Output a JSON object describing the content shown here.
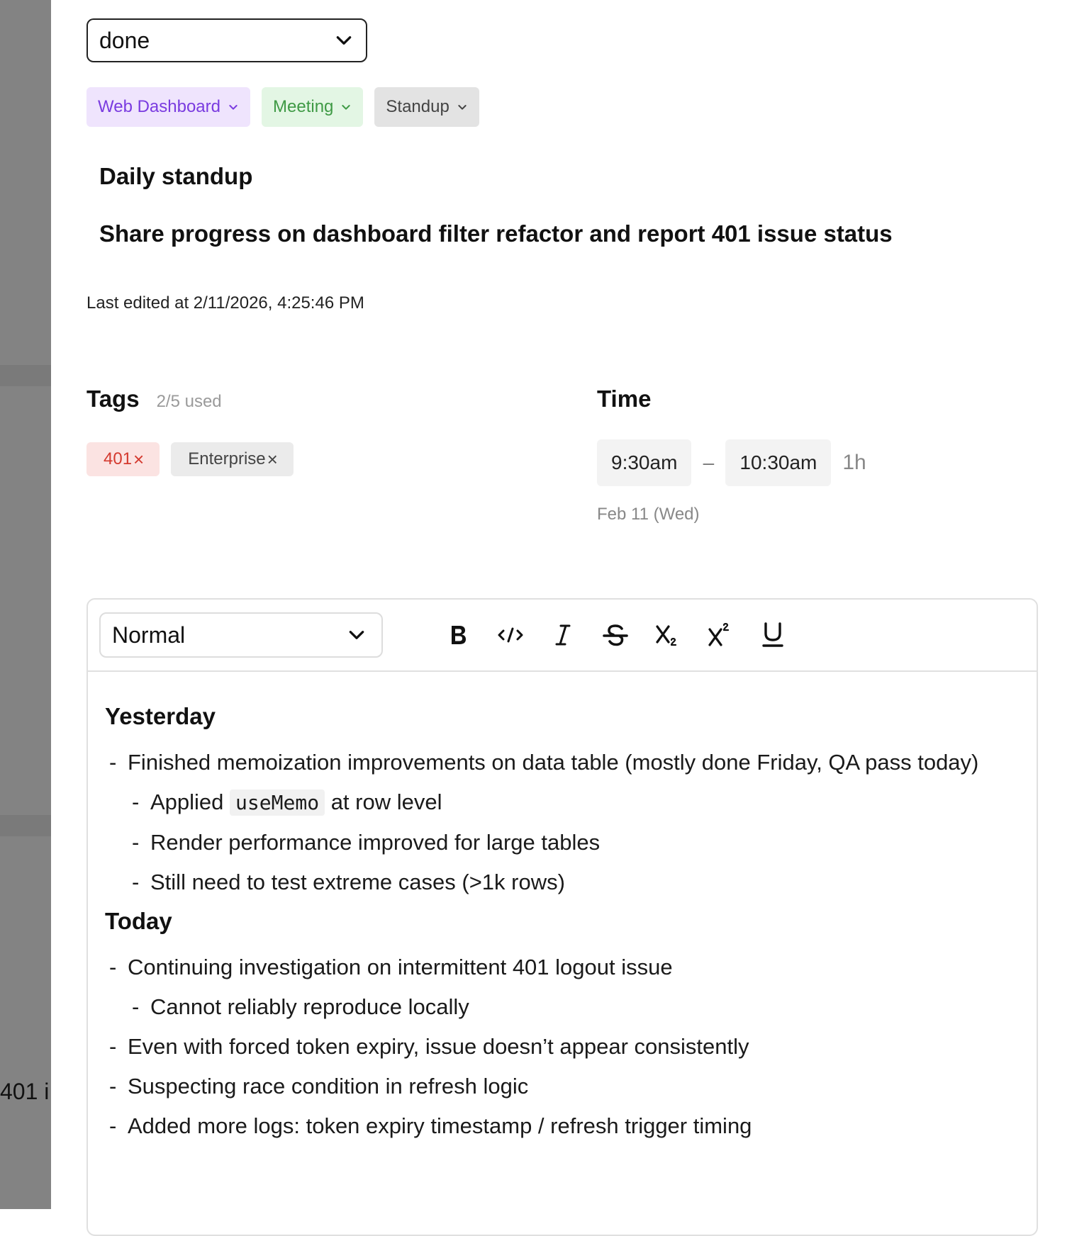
{
  "backdrop": {
    "peek_text": "401 i"
  },
  "status": {
    "value": "done"
  },
  "chips": [
    {
      "label": "Web Dashboard",
      "bg": "#efe4fd",
      "fg": "#7a3be0"
    },
    {
      "label": "Meeting",
      "bg": "#e3f6e4",
      "fg": "#3f9a45"
    },
    {
      "label": "Standup",
      "bg": "#e3e3e3",
      "fg": "#444444"
    }
  ],
  "title": "Daily standup",
  "subtitle": "Share progress on dashboard filter refactor and report 401 issue status",
  "last_edited": "Last edited at 2/11/2026, 4:25:46 PM",
  "tags": {
    "title": "Tags",
    "count": "2/5 used",
    "items": [
      {
        "label": "401",
        "remove": "×"
      },
      {
        "label": "Enterprise",
        "remove": "×"
      }
    ]
  },
  "time": {
    "title": "Time",
    "start": "9:30am",
    "separator": "–",
    "end": "10:30am",
    "duration": "1h",
    "date": "Feb 11 (Wed)"
  },
  "editor": {
    "format": "Normal",
    "toolbar": [
      "bold",
      "code",
      "italic",
      "strikethrough",
      "subscript",
      "superscript",
      "underline"
    ],
    "sections": [
      {
        "heading": "Yesterday",
        "item1": "Finished memoization improvements on data table (mostly done Friday, QA pass today)",
        "sub1_pre": "Applied",
        "sub1_code": "useMemo",
        "sub1_post": "at row level",
        "sub2": "Render performance improved for large tables",
        "sub3": "Still need to test extreme cases (>1k rows)"
      },
      {
        "heading": "Today",
        "item1": "Continuing investigation on intermittent 401 logout issue",
        "sub1": "Cannot reliably reproduce locally",
        "item2": "Even with forced token expiry, issue doesn’t appear consistently",
        "item3": "Suspecting race condition in refresh logic",
        "item4": "Added more logs: token expiry timestamp / refresh trigger timing"
      }
    ]
  }
}
